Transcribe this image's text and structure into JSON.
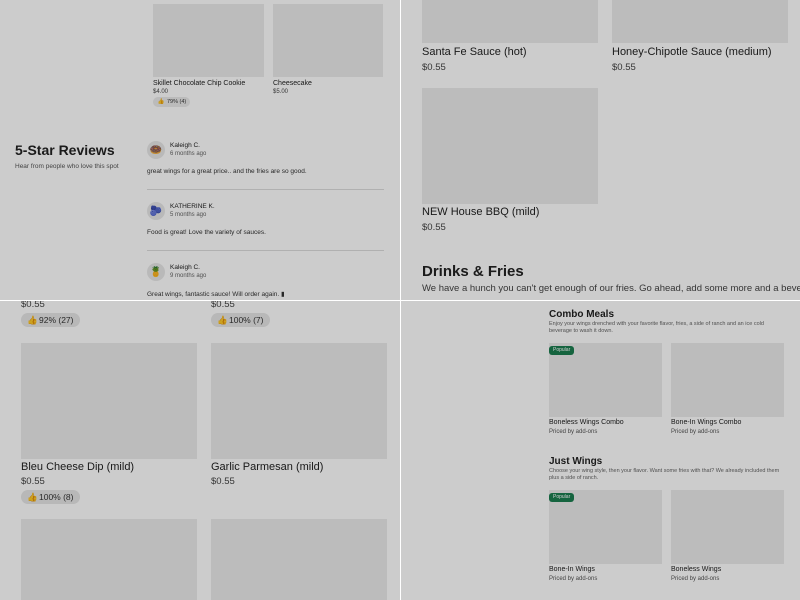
{
  "q1": {
    "products": [
      {
        "name": "Skillet Chocolate Chip Cookie",
        "price": "$4.00",
        "rating": "79% (4)"
      },
      {
        "name": "Cheesecake",
        "price": "$5.00"
      }
    ],
    "reviews_section": {
      "title": "5-Star Reviews",
      "subtitle": "Hear from people who love this spot",
      "reviews": [
        {
          "name": "Kaleigh C.",
          "time": "6 months ago",
          "text": "great wings for a great price.. and the fries are so good.",
          "avatar": "🍩"
        },
        {
          "name": "KATHERINE K.",
          "time": "5 months ago",
          "text": "Food is great! Love the variety of sauces.",
          "avatar": "🫐"
        },
        {
          "name": "Kaleigh C.",
          "time": "9 months ago",
          "text": "Great wings, fantastic sauce! Will order again. ▮",
          "avatar": "🍍"
        }
      ]
    }
  },
  "q2": {
    "sauces": [
      {
        "name": "Santa Fe Sauce (hot)",
        "price": "$0.55"
      },
      {
        "name": "Honey-Chipotle Sauce (medium)",
        "price": "$0.55"
      },
      {
        "name": "NEW House BBQ (mild)",
        "price": "$0.55"
      }
    ],
    "section": {
      "title": "Drinks & Fries",
      "desc": "We have a hunch you can't get enough of our fries. Go ahead, add some more and a beverage"
    }
  },
  "q3": {
    "top_prices": [
      {
        "price": "$0.55",
        "rating": "92% (27)"
      },
      {
        "price": "$0.55",
        "rating": "100% (7)"
      }
    ],
    "dips": [
      {
        "name": "Bleu Cheese Dip (mild)",
        "price": "$0.55",
        "rating": "100% (8)"
      },
      {
        "name": "Garlic Parmesan (mild)",
        "price": "$0.55"
      }
    ]
  },
  "q4": {
    "categories": [
      {
        "title": "Combo Meals",
        "desc": "Enjoy your wings drenched with your favorite flavor, fries, a side of ranch and an ice cold beverage to wash it down.",
        "items": [
          {
            "name": "Boneless Wings Combo",
            "price": "Priced by add-ons",
            "badge": "Popular"
          },
          {
            "name": "Bone-In Wings Combo",
            "price": "Priced by add-ons"
          }
        ]
      },
      {
        "title": "Just Wings",
        "desc": "Choose your wing style, then your flavor. Want some fries with that? We already included them plus a side of ranch.",
        "items": [
          {
            "name": "Bone-In Wings",
            "price": "Priced by add-ons",
            "badge": "Popular"
          },
          {
            "name": "Boneless Wings",
            "price": "Priced by add-ons"
          }
        ]
      }
    ]
  },
  "icons": {
    "thumb": "thumbs-up-icon"
  },
  "colors": {
    "badge": "#1b7d4f",
    "overlay": "rgba(0,0,0,0.2)"
  }
}
